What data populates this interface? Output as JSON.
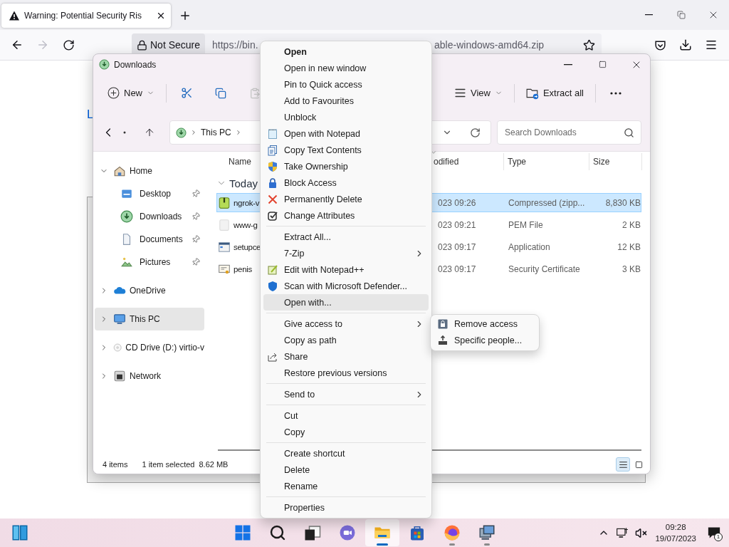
{
  "browser": {
    "tabs": [
      {
        "title": "Warning: Potential Security Ris",
        "selected": true
      }
    ],
    "security_label": "Not Secure",
    "url_start": "https://bin.",
    "url_end": "able-windows-amd64.zip",
    "forward_disabled": true,
    "page_link": "L"
  },
  "explorer": {
    "title": "Downloads",
    "toolbar": {
      "new_label": "New",
      "view_label": "View",
      "extract_label": "Extract all",
      "paste_disabled": true
    },
    "address": [
      "This PC"
    ],
    "search_placeholder": "Search Downloads",
    "sidebar": [
      {
        "label": "Home",
        "kind": "home",
        "expanded": true,
        "selected": false,
        "children": [
          {
            "label": "Desktop",
            "kind": "desktop",
            "pinned": true,
            "selected": false
          },
          {
            "label": "Downloads",
            "kind": "downloads",
            "pinned": true,
            "selected": false
          },
          {
            "label": "Documents",
            "kind": "documents",
            "pinned": true,
            "selected": false
          },
          {
            "label": "Pictures",
            "kind": "pictures",
            "pinned": true,
            "selected": false
          }
        ]
      },
      {
        "label": "OneDrive",
        "kind": "onedrive",
        "expanded": false,
        "selected": false
      },
      {
        "label": "This PC",
        "kind": "pc",
        "expanded": false,
        "selected": true
      },
      {
        "label": "CD Drive (D:) virtio-v",
        "kind": "cd",
        "expanded": false,
        "selected": false
      },
      {
        "label": "Network",
        "kind": "network",
        "expanded": false,
        "selected": false
      }
    ],
    "columns": [
      "Name",
      "odified",
      "Type",
      "Size"
    ],
    "groups": [
      {
        "label": "Today",
        "expanded": true,
        "rows": [
          {
            "name": "ngrok-v",
            "modified": "023 09:26",
            "type": "Compressed (zipp...",
            "size": "8,830 KB",
            "kind": "zip",
            "selected": true
          },
          {
            "name": "www-g",
            "modified": "023 09:21",
            "type": "PEM File",
            "size": "2 KB",
            "kind": "blank",
            "selected": false
          },
          {
            "name": "setupce",
            "modified": "023 09:17",
            "type": "Application",
            "size": "12 KB",
            "kind": "app",
            "selected": false
          },
          {
            "name": "penis",
            "modified": "023 09:17",
            "type": "Security Certificate",
            "size": "3 KB",
            "kind": "cert",
            "selected": false
          }
        ]
      }
    ],
    "status": {
      "count": "4 items",
      "selection": "1 item selected",
      "size": "8.62 MB"
    },
    "view_modes": [
      {
        "kind": "details",
        "selected": true
      },
      {
        "kind": "tiles",
        "selected": false
      }
    ]
  },
  "context_menu": {
    "groups": [
      [
        {
          "label": "Open",
          "kind": "none",
          "default": true,
          "submenu": false,
          "highlighted": false
        },
        {
          "label": "Open in new window",
          "kind": "none",
          "default": false,
          "submenu": false,
          "highlighted": false
        },
        {
          "label": "Pin to Quick access",
          "kind": "none",
          "default": false,
          "submenu": false,
          "highlighted": false
        },
        {
          "label": "Add to Favourites",
          "kind": "none",
          "default": false,
          "submenu": false,
          "highlighted": false
        },
        {
          "label": "Unblock",
          "kind": "none",
          "default": false,
          "submenu": false,
          "highlighted": false
        },
        {
          "label": "Open with Notepad",
          "kind": "notepad",
          "default": false,
          "submenu": false,
          "highlighted": false
        },
        {
          "label": "Copy Text Contents",
          "kind": "copytext",
          "default": false,
          "submenu": false,
          "highlighted": false
        },
        {
          "label": "Take Ownership",
          "kind": "ownership",
          "default": false,
          "submenu": false,
          "highlighted": false
        },
        {
          "label": "Block Access",
          "kind": "lock",
          "default": false,
          "submenu": false,
          "highlighted": false
        },
        {
          "label": "Permanently Delete",
          "kind": "delete",
          "default": false,
          "submenu": false,
          "highlighted": false
        },
        {
          "label": "Change Attributes",
          "kind": "attributes",
          "default": false,
          "submenu": false,
          "highlighted": false
        }
      ],
      [
        {
          "label": "Extract All...",
          "kind": "none",
          "default": false,
          "submenu": false,
          "highlighted": false
        },
        {
          "label": "7-Zip",
          "kind": "none",
          "default": false,
          "submenu": true,
          "highlighted": false
        },
        {
          "label": "Edit with Notepad++",
          "kind": "notepadpp",
          "default": false,
          "submenu": false,
          "highlighted": false
        },
        {
          "label": "Scan with Microsoft Defender...",
          "kind": "defender",
          "default": false,
          "submenu": false,
          "highlighted": false
        },
        {
          "label": "Open with...",
          "kind": "none",
          "default": false,
          "submenu": false,
          "highlighted": true
        }
      ],
      [
        {
          "label": "Give access to",
          "kind": "none",
          "default": false,
          "submenu": true,
          "highlighted": false
        },
        {
          "label": "Copy as path",
          "kind": "none",
          "default": false,
          "submenu": false,
          "highlighted": false
        },
        {
          "label": "Share",
          "kind": "share",
          "default": false,
          "submenu": false,
          "highlighted": false
        },
        {
          "label": "Restore previous versions",
          "kind": "none",
          "default": false,
          "submenu": false,
          "highlighted": false
        }
      ],
      [
        {
          "label": "Send to",
          "kind": "none",
          "default": false,
          "submenu": true,
          "highlighted": false
        }
      ],
      [
        {
          "label": "Cut",
          "kind": "none",
          "default": false,
          "submenu": false,
          "highlighted": false
        },
        {
          "label": "Copy",
          "kind": "none",
          "default": false,
          "submenu": false,
          "highlighted": false
        }
      ],
      [
        {
          "label": "Create shortcut",
          "kind": "none",
          "default": false,
          "submenu": false,
          "highlighted": false
        },
        {
          "label": "Delete",
          "kind": "none",
          "default": false,
          "submenu": false,
          "highlighted": false
        },
        {
          "label": "Rename",
          "kind": "none",
          "default": false,
          "submenu": false,
          "highlighted": false
        }
      ],
      [
        {
          "label": "Properties",
          "kind": "none",
          "default": false,
          "submenu": false,
          "highlighted": false
        }
      ]
    ]
  },
  "submenu": [
    {
      "label": "Remove access",
      "kind": "remove"
    },
    {
      "label": "Specific people...",
      "kind": "people"
    }
  ],
  "taskbar": {
    "apps": [
      {
        "kind": "start",
        "active": false,
        "running": false
      },
      {
        "kind": "search",
        "active": false,
        "running": false
      },
      {
        "kind": "taskview",
        "active": false,
        "running": false
      },
      {
        "kind": "chat",
        "active": false,
        "running": false
      },
      {
        "kind": "explorer",
        "active": true,
        "running": true
      },
      {
        "kind": "store",
        "active": false,
        "running": false
      },
      {
        "kind": "firefox",
        "active": false,
        "running": true
      },
      {
        "kind": "remote",
        "active": false,
        "running": true
      }
    ],
    "time": "09:28",
    "date": "19/07/2023",
    "notifications": "1"
  }
}
